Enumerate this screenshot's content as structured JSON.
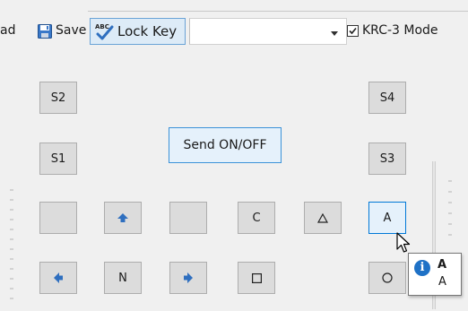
{
  "toolbar": {
    "load_label_partial": "ad",
    "save_label": "Save",
    "lock_key_label": "Lock Key",
    "key_combo_value": "",
    "mode_label": "KRC-3 Mode",
    "mode_checked": true,
    "icons": {
      "save": "floppy-disk-icon",
      "lock_key": "spellcheck-icon",
      "combo": "dropdown-arrow-icon"
    }
  },
  "keypad": {
    "s2": "S2",
    "s4": "S4",
    "s1": "S1",
    "s3": "S3",
    "send": "Send ON/OFF",
    "blank_left": "",
    "up_icon": "arrow-up-icon",
    "blank_mid": "",
    "c": "C",
    "triangle_icon": "triangle-icon",
    "a": "A",
    "left_icon": "arrow-left-icon",
    "n": "N",
    "right_icon": "arrow-right-icon",
    "square_icon": "square-icon",
    "circle_icon": "circle-icon"
  },
  "tooltip": {
    "title": "A",
    "text": "A",
    "icon": "info-icon"
  },
  "colors": {
    "accent": "#0078d7",
    "hover_fill": "#e5f1fb",
    "key_fill": "#dcdcdc",
    "arrow_blue": "#2f6fbf",
    "info_blue": "#1e71c6"
  }
}
